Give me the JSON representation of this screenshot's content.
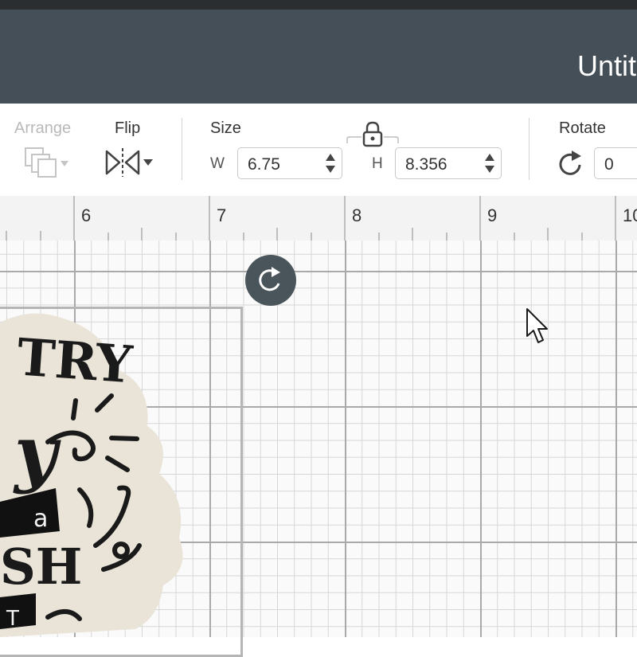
{
  "window": {
    "title": "Untit"
  },
  "toolbar": {
    "arrange_label": "Arrange",
    "flip_label": "Flip",
    "size_label": "Size",
    "width_letter": "W",
    "width_value": "6.75",
    "height_letter": "H",
    "height_value": "8.356",
    "rotate_label": "Rotate",
    "rotate_value": "0"
  },
  "ruler": {
    "marks": [
      "6",
      "7",
      "8",
      "9",
      "10"
    ]
  },
  "design": {
    "lines": [
      "TRY",
      "y",
      "a",
      "SH",
      "T"
    ]
  },
  "colors": {
    "titlebar": "#444f57",
    "design_backdrop": "#e9e4d7",
    "grid_major": "#a9a9a9"
  }
}
